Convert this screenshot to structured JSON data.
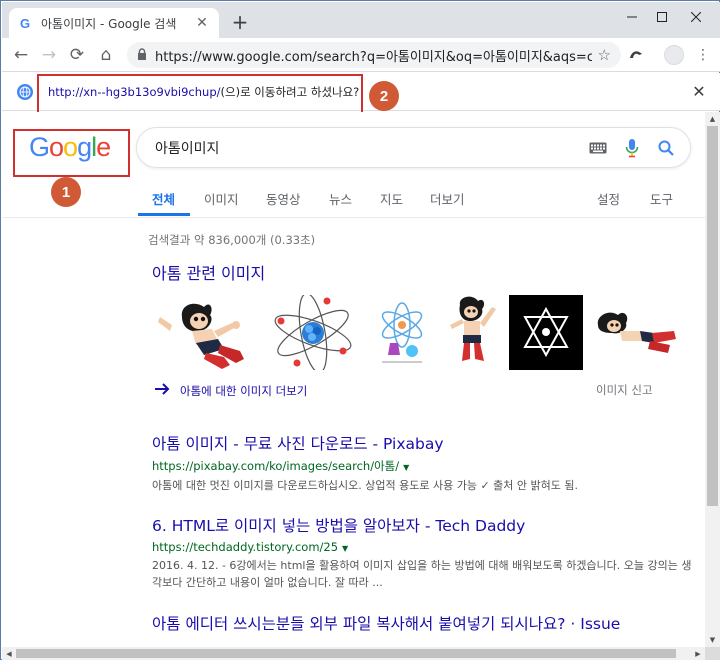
{
  "browser": {
    "tab_title": "아톰이미지 - Google 검색",
    "favicon": "G",
    "new_tab": "+",
    "address": "https://www.google.com/search?q=아톰이미지&oq=아톰이미지&aqs=chr..."
  },
  "infobar": {
    "url": "http://xn--hg3b13o9vbi9chup/",
    "message": "(으)로 이동하려고 하셨나요?"
  },
  "badges": {
    "first": "1",
    "second": "2"
  },
  "search": {
    "logo_letters": [
      "G",
      "o",
      "o",
      "g",
      "l",
      "e"
    ],
    "logo_colors": [
      "#4285f4",
      "#ea4335",
      "#fbbc05",
      "#4285f4",
      "#34a853",
      "#ea4335"
    ],
    "query": "아톰이미지",
    "tabs": [
      "전체",
      "이미지",
      "동영상",
      "뉴스",
      "지도",
      "더보기"
    ],
    "settings": "설정",
    "tools": "도구",
    "stats": "검색결과 약 836,000개 (0.33초)"
  },
  "images_section": {
    "heading": "아톰 관련 이미지",
    "more_label": "아톰에 대한 이미지 더보기",
    "report_label": "이미지 신고"
  },
  "results": [
    {
      "title": "아톰 이미지 - 무료 사진 다운로드 - Pixabay",
      "url": "https://pixabay.com/ko/images/search/아톰/",
      "snippet": "아톰에 대한 멋진 이미지를 다운로드하십시오. 상업적 용도로 사용 가능 ✓ 출처 안 밝혀도 됨."
    },
    {
      "title": "6. HTML로 이미지 넣는 방법을 알아보자 - Tech Daddy",
      "url": "https://techdaddy.tistory.com/25",
      "snippet": "2016. 4. 12. - 6강에서는 html을 활용하여 이미지 삽입을 하는 방법에 대해 배워보도록 하겠습니다. 오늘 강의는 생각보다 간단하고 내용이 얼마 없습니다. 잘 따라 ..."
    },
    {
      "title": "아톰 에디터 쓰시는분들 외부 파일 복사해서 붙여넣기 되시나요? · Issue",
      "url": "",
      "snippet": ""
    }
  ],
  "colors": {
    "link": "#1a0dab",
    "url_green": "#006621",
    "accent_blue": "#1a73e8",
    "annotation_red": "#d32f2f",
    "badge_orange": "#d05a36"
  },
  "icons": [
    "back-icon",
    "forward-icon",
    "reload-icon",
    "lock-icon",
    "star-icon",
    "extension-icon",
    "globe-icon",
    "keyboard-icon",
    "microphone-icon",
    "search-icon"
  ]
}
